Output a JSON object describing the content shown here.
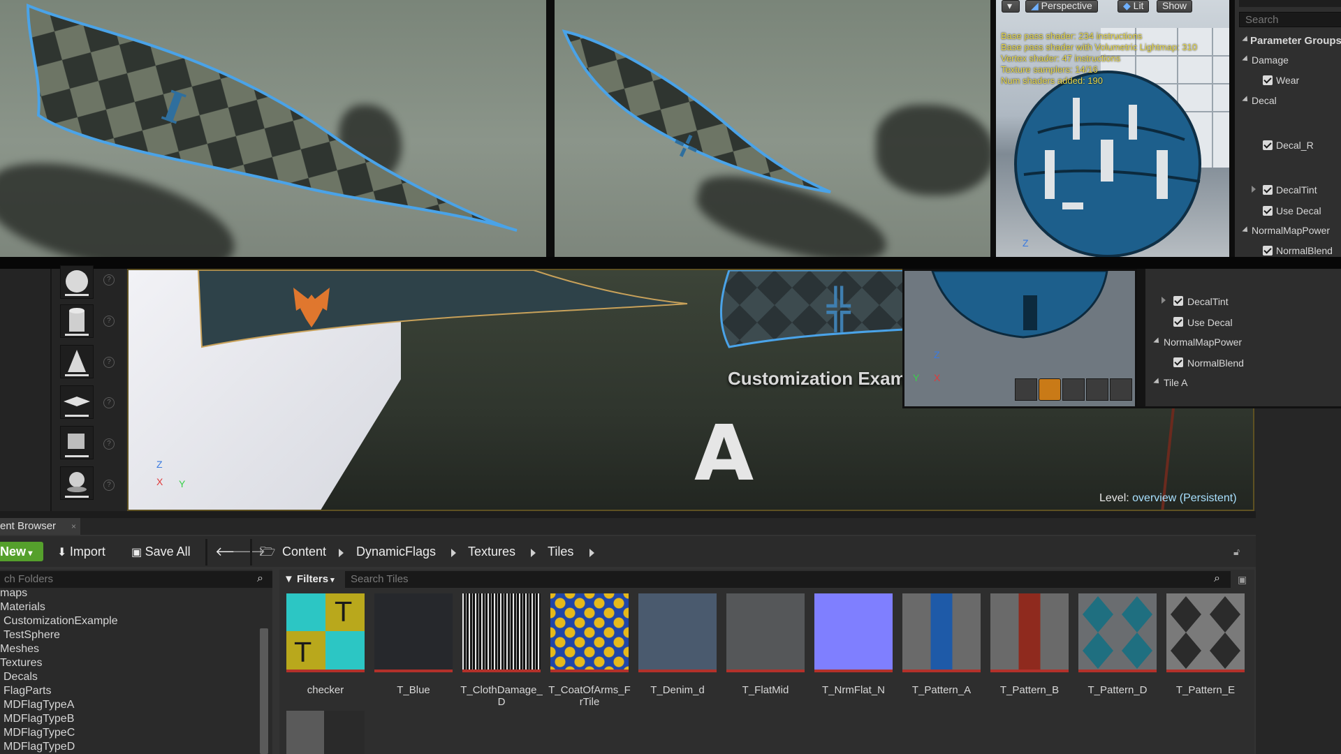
{
  "preview_toolbar": {
    "perspective": "Perspective",
    "lit": "Lit",
    "show": "Show"
  },
  "shader_stats": [
    "Base pass shader: 234 instructions",
    "Base pass shader with Volumetric Lightmap: 310",
    "Vertex shader: 47 instructions",
    "Texture samplers: 14/16",
    "Num shaders added: 190"
  ],
  "details": {
    "search_placeholder": "Search",
    "header": "Parameter Groups",
    "top_rows": {
      "damage": "Damage",
      "wear": "Wear",
      "decal": "Decal",
      "decal_r": "Decal_R",
      "decaltint": "DecalTint",
      "use_decal": "Use Decal",
      "normalmappower": "NormalMapPower",
      "normalblend": "NormalBlend"
    },
    "lower_rows": {
      "decaltint": "DecalTint",
      "use_decal": "Use Decal",
      "normalmappower": "NormalMapPower",
      "normalblend": "NormalBlend",
      "tile_a": "Tile A"
    }
  },
  "viewport_axes": {
    "z": "Z",
    "x": "X",
    "y": "Y"
  },
  "level": {
    "label": "Level:",
    "value": "overview (Persistent)",
    "scene_text": "Customization Example",
    "scene_letter": "A"
  },
  "content_browser": {
    "tab": "ent Browser",
    "new": "New",
    "import": "Import",
    "save_all": "Save All",
    "breadcrumb": [
      "Content",
      "DynamicFlags",
      "Textures",
      "Tiles"
    ],
    "folder_search_placeholder": "ch Folders",
    "filters": "Filters",
    "asset_search_placeholder": "Search Tiles",
    "folders": [
      "maps",
      "Materials",
      "CustomizationExample",
      "TestSphere",
      "Meshes",
      "Textures",
      "Decals",
      "FlagParts",
      "MDFlagTypeA",
      "MDFlagTypeB",
      "MDFlagTypeC",
      "MDFlagTypeD"
    ],
    "assets": [
      {
        "name": "checker"
      },
      {
        "name": "T_Blue"
      },
      {
        "name": "T_ClothDamage_D"
      },
      {
        "name": "T_CoatOfArms_FrTile"
      },
      {
        "name": "T_Denim_d"
      },
      {
        "name": "T_FlatMid"
      },
      {
        "name": "T_NrmFlat_N"
      },
      {
        "name": "T_Pattern_A"
      },
      {
        "name": "T_Pattern_B"
      },
      {
        "name": "T_Pattern_D"
      },
      {
        "name": "T_Pattern_E"
      }
    ]
  },
  "colors": {
    "new_button": "#55a02c",
    "flag_outline": "#4aa3e8",
    "stats_text": "#e8d84a",
    "normal_flat": "#7f7fff"
  }
}
